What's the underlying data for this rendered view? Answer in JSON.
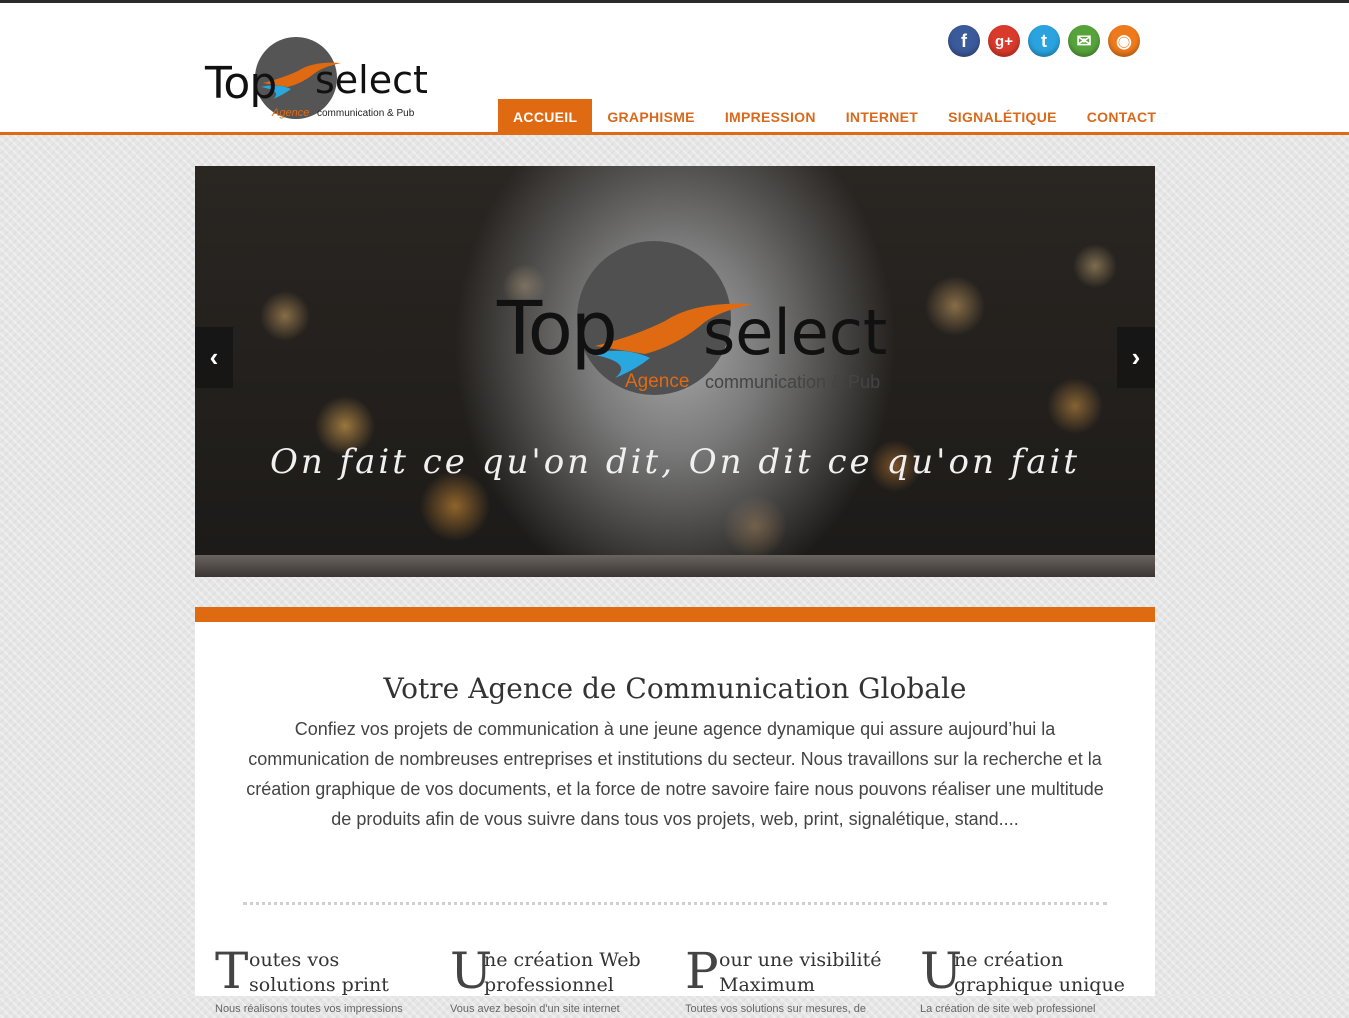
{
  "brand": {
    "top": "Top",
    "select": "select",
    "agence": "Agence",
    "subtitle": "communication & Pub"
  },
  "social": [
    {
      "name": "facebook-icon",
      "glyph": "f"
    },
    {
      "name": "google-plus-icon",
      "glyph": "g+"
    },
    {
      "name": "twitter-icon",
      "glyph": "t"
    },
    {
      "name": "mail-icon",
      "glyph": "✉"
    },
    {
      "name": "rss-icon",
      "glyph": "◉"
    }
  ],
  "nav": {
    "items": [
      "ACCUEIL",
      "GRAPHISME",
      "IMPRESSION",
      "INTERNET",
      "SIGNALÉTIQUE",
      "CONTACT"
    ],
    "active": "ACCUEIL"
  },
  "slider": {
    "tagline": "On fait ce qu'on dit, On dit ce qu'on fait",
    "prev": "‹",
    "next": "›"
  },
  "main": {
    "title": "Votre Agence de Communication Globale",
    "body": "Confiez vos projets de communication à une jeune agence dynamique qui assure aujourd’hui la communication de nombreuses entreprises et institutions du secteur. Nous travaillons sur la recherche et la création graphique de vos documents, et la force de notre savoire faire nous pouvons réaliser une multitude de produits afin de vous suivre dans tous vos projets, web, print, signalétique, stand...."
  },
  "features": [
    {
      "initial": "T",
      "title": "outes vos solutions print",
      "desc": "Nous réalisons toutes vos impressions"
    },
    {
      "initial": "U",
      "title": "ne création Web professionnel",
      "desc": "Vous avez besoin d'un site internet"
    },
    {
      "initial": "P",
      "title": "our une visibilité Maximum",
      "desc": "Toutes vos solutions sur mesures, de"
    },
    {
      "initial": "U",
      "title": "ne création graphique unique",
      "desc": "La création de site web professionel"
    }
  ],
  "colors": {
    "accent": "#e06a12",
    "topbar": "#2b2b2b"
  }
}
